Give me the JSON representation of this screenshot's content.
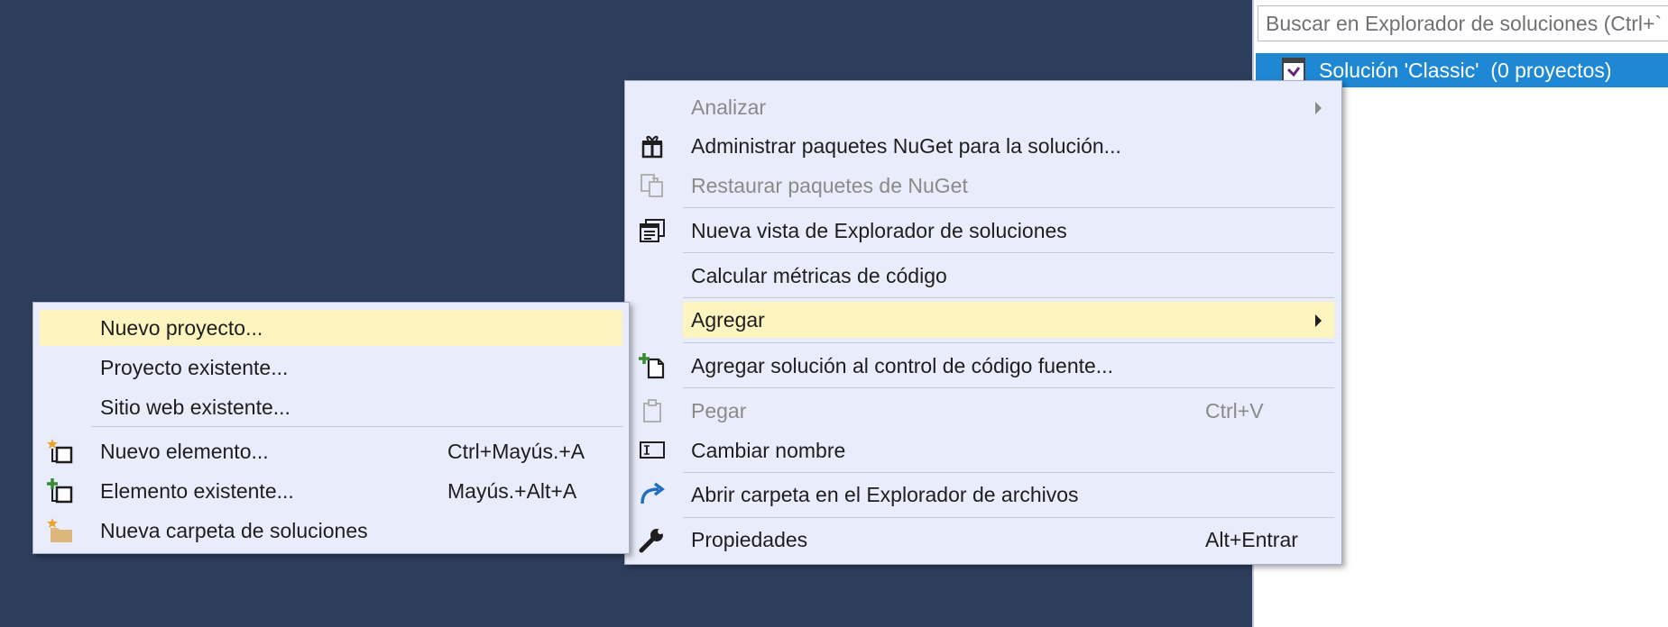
{
  "solution_explorer": {
    "search_placeholder": "Buscar en Explorador de soluciones (Ctrl+`",
    "solution_label": "Solución 'Classic'  (0 proyectos)",
    "selection_color": "#1e88d4"
  },
  "context_menu": {
    "items": [
      {
        "label": "Analizar",
        "shortcut": "",
        "icon": "",
        "disabled": true,
        "submenu": true
      },
      {
        "label": "Administrar paquetes NuGet para la solución...",
        "shortcut": "",
        "icon": "nuget-package-icon"
      },
      {
        "label": "Restaurar paquetes de NuGet",
        "shortcut": "",
        "icon": "restore-packages-icon",
        "disabled": true
      },
      {
        "label": "Nueva vista de Explorador de soluciones",
        "shortcut": "",
        "icon": "new-view-icon"
      },
      {
        "label": "Calcular métricas de código",
        "shortcut": "",
        "icon": ""
      },
      {
        "label": "Agregar",
        "shortcut": "",
        "icon": "",
        "submenu": true,
        "highlighted": true
      },
      {
        "label": "Agregar solución al control de código fuente...",
        "shortcut": "",
        "icon": "add-source-control-icon"
      },
      {
        "label": "Pegar",
        "shortcut": "Ctrl+V",
        "icon": "paste-icon",
        "disabled": true
      },
      {
        "label": "Cambiar nombre",
        "shortcut": "",
        "icon": "rename-icon"
      },
      {
        "label": "Abrir carpeta en el Explorador de archivos",
        "shortcut": "",
        "icon": "open-folder-icon"
      },
      {
        "label": "Propiedades",
        "shortcut": "Alt+Entrar",
        "icon": "wrench-icon"
      }
    ]
  },
  "add_submenu": {
    "items": [
      {
        "label": "Nuevo proyecto...",
        "shortcut": "",
        "icon": "",
        "highlighted": true
      },
      {
        "label": "Proyecto existente...",
        "shortcut": "",
        "icon": ""
      },
      {
        "label": "Sitio web existente...",
        "shortcut": "",
        "icon": ""
      },
      {
        "label": "Nuevo elemento...",
        "shortcut": "Ctrl+Mayús.+A",
        "icon": "new-item-icon"
      },
      {
        "label": "Elemento existente...",
        "shortcut": "Mayús.+Alt+A",
        "icon": "existing-item-icon"
      },
      {
        "label": "Nueva carpeta de soluciones",
        "shortcut": "",
        "icon": "new-solution-folder-icon"
      }
    ]
  },
  "colors": {
    "background": "#2d3e5c",
    "menu_background": "#e9ecfa",
    "highlight": "#fdf4bf"
  }
}
